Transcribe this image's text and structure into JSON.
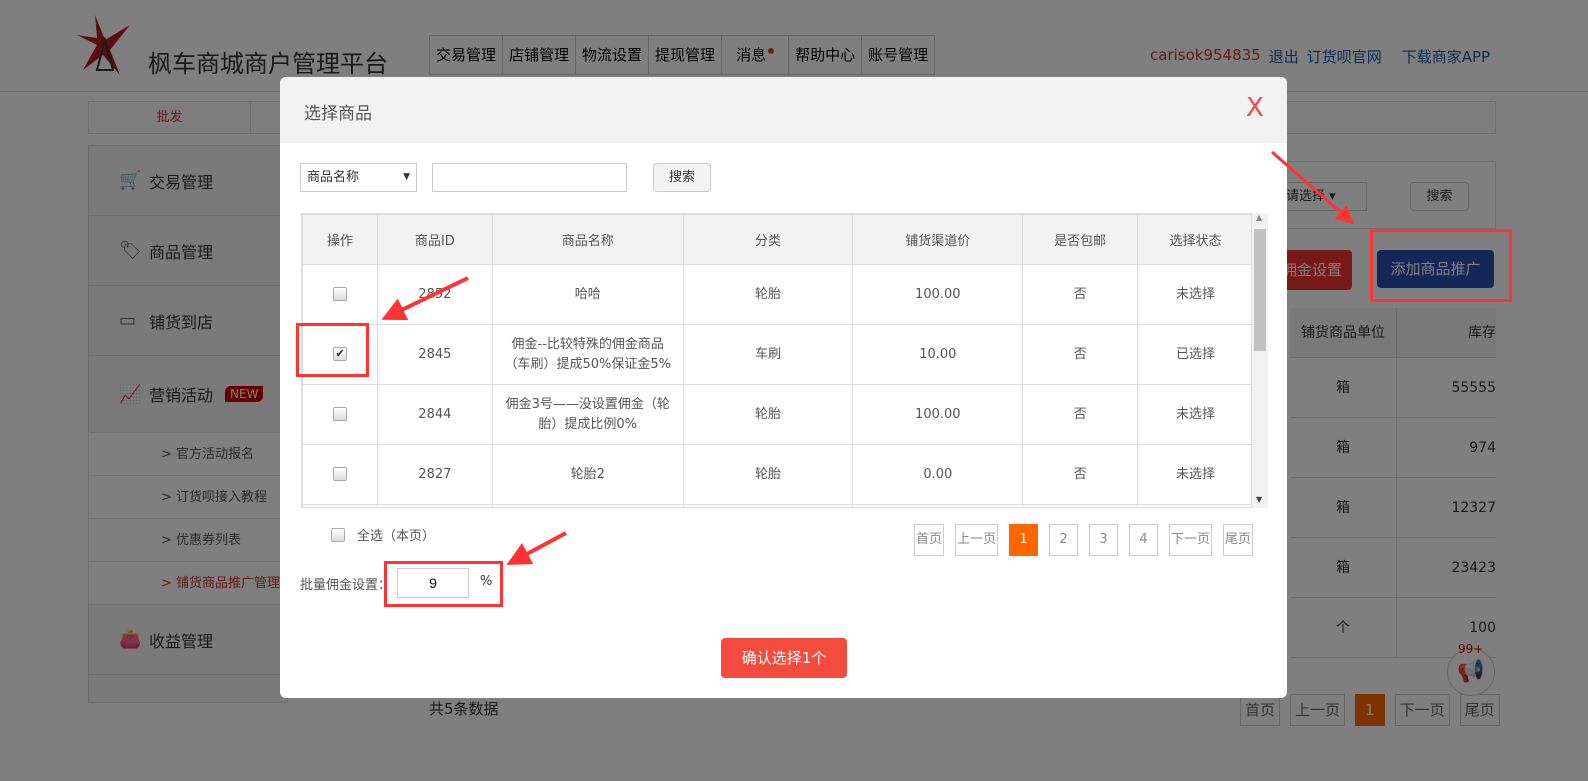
{
  "header": {
    "site_title": "枫车商城商户管理平台",
    "nav": [
      "交易管理",
      "店铺管理",
      "物流设置",
      "提现管理",
      "消息",
      "帮助中心",
      "账号管理"
    ],
    "username": "carisok954835",
    "logout": "退出",
    "official_site": "订货呗官网",
    "download_app": "下载商家APP"
  },
  "tabs": {
    "active": "批发"
  },
  "sidebar": {
    "items": [
      {
        "label": "交易管理",
        "icon": "cart-icon"
      },
      {
        "label": "商品管理",
        "icon": "tag-icon"
      },
      {
        "label": "铺货到店",
        "icon": "store-icon"
      },
      {
        "label": "营销活动",
        "icon": "chart-icon",
        "badge": "NEW"
      }
    ],
    "subitems": [
      "官方活动报名",
      "订货呗接入教程",
      "优惠券列表",
      "铺货商品推广管理"
    ],
    "last": {
      "label": "收益管理",
      "icon": "wallet-icon"
    }
  },
  "background": {
    "select_placeholder": "请选择",
    "search": "搜索",
    "commission_button": "佣金设置",
    "add_promo_button": "添加商品推广",
    "columns": [
      "铺货商品单位",
      "库存"
    ],
    "rows": [
      [
        "箱",
        "55555"
      ],
      [
        "箱",
        "974"
      ],
      [
        "箱",
        "12327"
      ],
      [
        "箱",
        "23423"
      ],
      [
        "个",
        "100"
      ]
    ],
    "total": "共5条数据",
    "pagination": [
      "首页",
      "上一页",
      "1",
      "下一页",
      "尾页"
    ],
    "notif_count": "99+"
  },
  "modal": {
    "title": "选择商品",
    "close": "X",
    "filter_select": "商品名称",
    "search_value": "",
    "search_button": "搜索",
    "columns": [
      "操作",
      "商品ID",
      "商品名称",
      "分类",
      "铺货渠道价",
      "是否包邮",
      "选择状态"
    ],
    "rows": [
      {
        "checked": false,
        "id": "2852",
        "name": "哈哈",
        "category": "轮胎",
        "price": "100.00",
        "free_ship": "否",
        "status": "未选择"
      },
      {
        "checked": true,
        "id": "2845",
        "name": "佣金--比较特殊的佣金商品（车刷）提成50%保证金5%",
        "category": "车刷",
        "price": "10.00",
        "free_ship": "否",
        "status": "已选择"
      },
      {
        "checked": false,
        "id": "2844",
        "name": "佣金3号——没设置佣金（轮胎）提成比例0%",
        "category": "轮胎",
        "price": "100.00",
        "free_ship": "否",
        "status": "未选择"
      },
      {
        "checked": false,
        "id": "2827",
        "name": "轮胎2",
        "category": "轮胎",
        "price": "0.00",
        "free_ship": "否",
        "status": "未选择"
      }
    ],
    "select_all": "全选（本页）",
    "pagination": [
      "首页",
      "上一页",
      "1",
      "2",
      "3",
      "4",
      "下一页",
      "尾页"
    ],
    "current_page": "1",
    "batch_label": "批量佣金设置：",
    "batch_value": "9",
    "batch_unit": "%",
    "confirm": "确认选择1个"
  },
  "colors": {
    "accent_red": "#f44b3f",
    "page_orange": "#ff6600",
    "promo_blue": "#2a4fb0"
  }
}
